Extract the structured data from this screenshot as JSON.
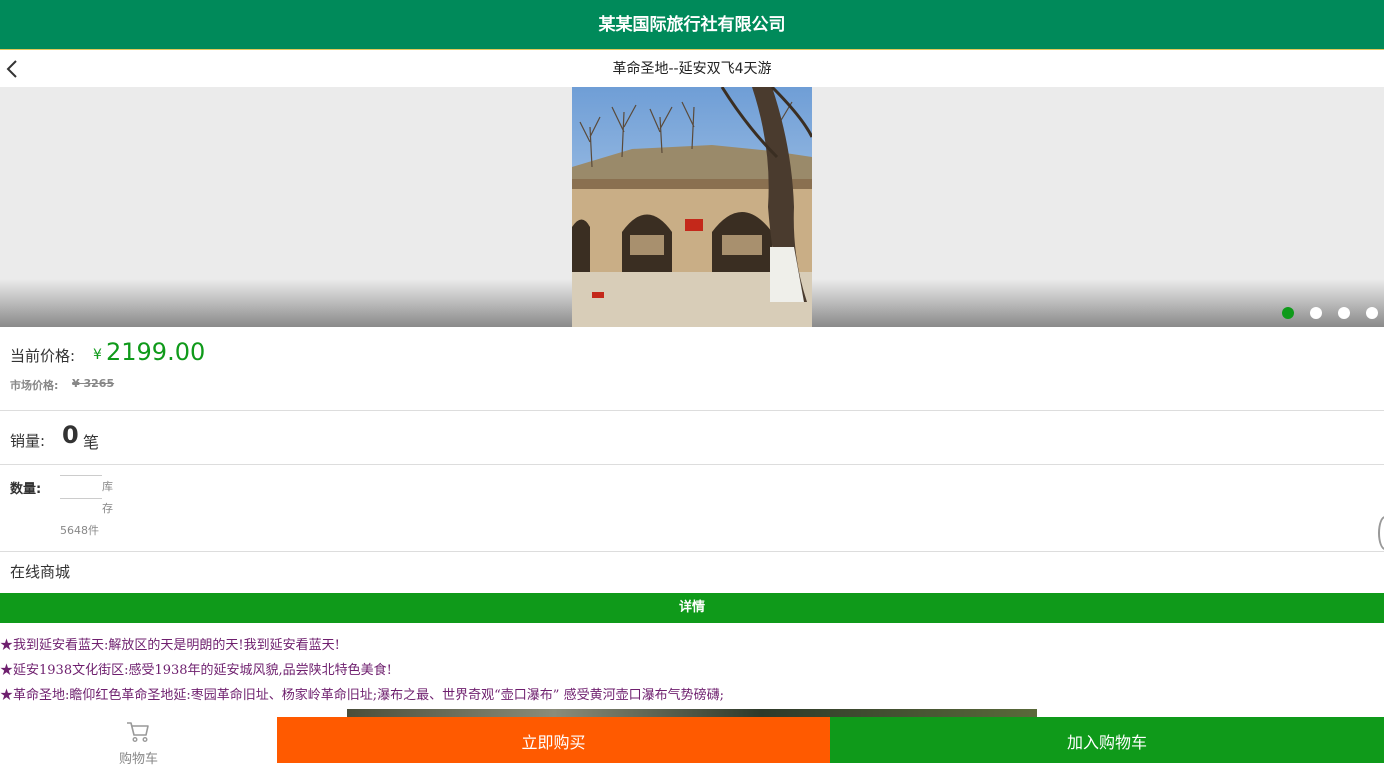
{
  "header": {
    "title": "某某国际旅行社有限公司"
  },
  "nav": {
    "title": "革命圣地--延安双飞4天游"
  },
  "banner": {
    "slide_count": 4,
    "active_index": 0
  },
  "price": {
    "current_label": "当前价格:",
    "currency": "¥",
    "current_value": "2199.00",
    "market_label": "市场价格:",
    "market_value": "¥ 3265"
  },
  "sales": {
    "label": "销量:",
    "count": "0",
    "unit": "笔"
  },
  "quantity": {
    "label": "数量:",
    "value": "",
    "stock_char1": "库",
    "stock_char2": "存",
    "stock_count": "5648件"
  },
  "mall": {
    "label": "在线商城"
  },
  "detail": {
    "tab_label": "详情"
  },
  "description": [
    "★我到延安看蓝天:解放区的天是明朗的天!我到延安看蓝天!",
    "★延安1938文化街区:感受1938年的延安城风貌,品尝陕北特色美食!",
    "★革命圣地:瞻仰红色革命圣地延:枣园革命旧址、杨家岭革命旧址;瀑布之最、世界奇观“壶口瀑布” 感受黄河壶口瀑布气势磅礴;"
  ],
  "bottom_bar": {
    "cart_label": "购物车",
    "buy_now_label": "立即购买",
    "add_to_cart_label": "加入购物车"
  },
  "colors": {
    "header": "#008a5a",
    "accent_green": "#0f9a1a",
    "buy_orange": "#ff5a00",
    "desc_text": "#6e1f6e"
  }
}
